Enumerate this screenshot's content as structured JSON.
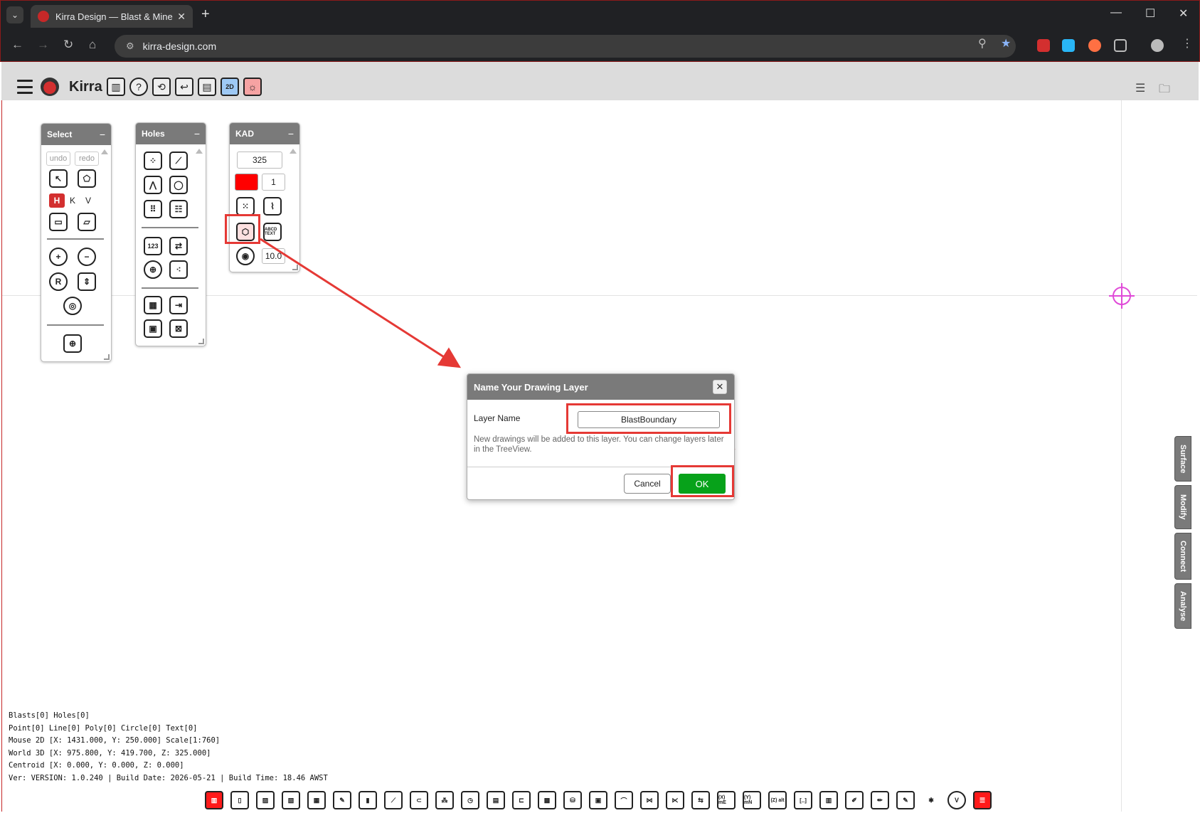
{
  "browser": {
    "tab_title": "Kirra Design — Blast & Mine De",
    "url": "kirra-design.com",
    "tab_close": "✕",
    "new_tab": "+",
    "minimize": "—",
    "maximize": "☐",
    "close": "✕"
  },
  "app": {
    "name": "Kirra",
    "toolbar_icons": [
      "book-icon",
      "help-icon",
      "refresh-icon",
      "undo-icon",
      "layout-icon",
      "2d-icon",
      "sun-icon"
    ],
    "twod_label": "2D"
  },
  "panels": {
    "select": {
      "title": "Select",
      "undo": "undo",
      "redo": "redo",
      "h": "H",
      "k": "K",
      "v": "V"
    },
    "holes": {
      "title": "Holes",
      "numbers_label": "123"
    },
    "kad": {
      "title": "KAD",
      "elevation": "325",
      "line_width": "1",
      "radius": "10.0",
      "color": "#ff0000",
      "text_label": "ABCD TEXT"
    }
  },
  "dialog": {
    "title": "Name Your Drawing Layer",
    "label": "Layer Name",
    "value": "BlastBoundary",
    "help": "New drawings will be added to this layer. You can change layers later in the TreeView.",
    "cancel": "Cancel",
    "ok": "OK",
    "close": "✕"
  },
  "side_tabs": [
    "Surface",
    "Modify",
    "Connect",
    "Analyse"
  ],
  "status": {
    "line1": "Blasts[0] Holes[0]",
    "line2": "Point[0] Line[0] Poly[0] Circle[0] Text[0]",
    "line3": "Mouse 2D [X: 1431.000, Y: 250.000] Scale[1:760]",
    "line4": "World 3D [X: 975.800, Y: 419.700, Z: 325.000]",
    "line5": "Centroid [X: 0.000, Y: 0.000, Z: 0.000]",
    "line6": "Ver: VERSION: 1.0.240 | Build Date: 2026-05-21 | Build Time: 18.46 AWST"
  },
  "bottom_tools": {
    "xme": "(X) mE",
    "ymn": "(Y) mN",
    "zalt": "(Z) alt",
    "bracket": "[..]"
  },
  "colors": {
    "accent_red": "#e53935",
    "ok_green": "#07a21a",
    "panel_header": "#7a7a7a",
    "crosshair": "#e04ad8"
  }
}
